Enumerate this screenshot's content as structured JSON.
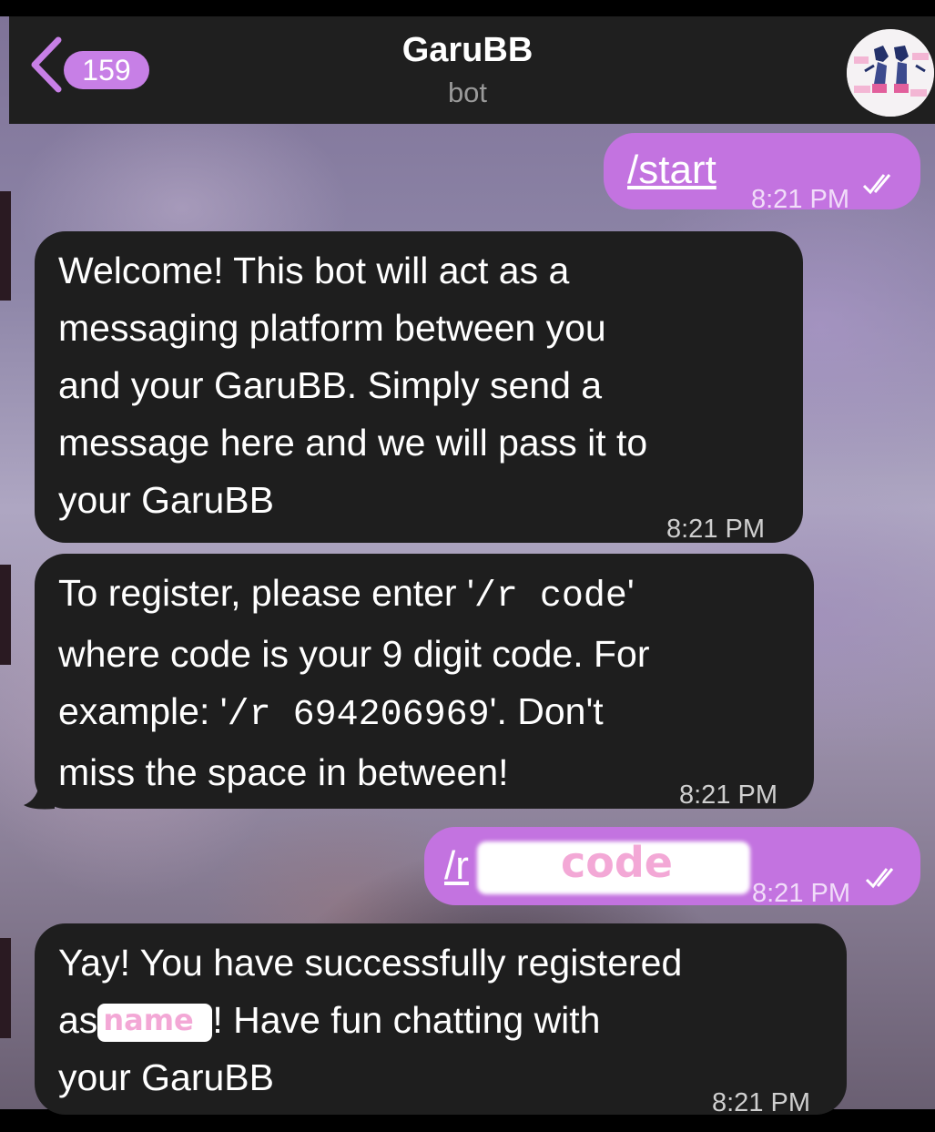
{
  "header": {
    "back_count": "159",
    "title": "GaruBB",
    "subtitle": "bot"
  },
  "messages": [
    {
      "dir": "out",
      "text": "/start",
      "time": "8:21 PM"
    },
    {
      "dir": "in",
      "lines": [
        "Welcome! This bot will act as a",
        "messaging platform between you",
        "and your GaruBB. Simply send a",
        "message here and we will pass it to",
        "your GaruBB"
      ],
      "time": "8:21 PM"
    },
    {
      "dir": "in",
      "line1_a": "To register, please enter '",
      "line1_code": "/r code",
      "line1_b": "'",
      "line2": "where code is your 9 digit code. For",
      "line3_a": "example: '",
      "line3_code": "/r 694206969",
      "line3_b": "'. Don't",
      "line4": "miss the space in between!",
      "time": "8:21 PM"
    },
    {
      "dir": "out",
      "prefix": "/r",
      "sticker": "code",
      "time": "8:21 PM"
    },
    {
      "dir": "in",
      "line1": "Yay! You have successfully registered",
      "line2_a": "as",
      "line2_sticker": "name",
      "line2_b": "! Have fun chatting with",
      "line3": "your GaruBB",
      "time": "8:21 PM"
    }
  ],
  "colors": {
    "accent": "#c373e0",
    "incoming_bubble": "#1e1e1e",
    "header_bg": "#1f1f1f"
  },
  "icons": {
    "back": "chevron-left-icon",
    "read": "double-check-icon"
  }
}
